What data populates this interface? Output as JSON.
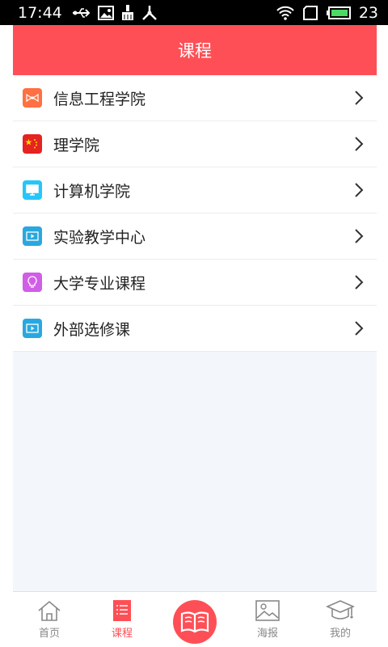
{
  "status_bar": {
    "time": "17:44",
    "battery_percent": "23"
  },
  "header": {
    "title": "课程"
  },
  "courses": [
    {
      "label": "信息工程学院",
      "icon": "bowtie-icon",
      "color": "#ff7043"
    },
    {
      "label": "理学院",
      "icon": "flag-icon",
      "color": "#e52320"
    },
    {
      "label": "计算机学院",
      "icon": "monitor-icon",
      "color": "#26c6f9"
    },
    {
      "label": "实验教学中心",
      "icon": "video-screen-icon",
      "color": "#29a8e0"
    },
    {
      "label": "大学专业课程",
      "icon": "lightbulb-icon",
      "color": "#d05ee6"
    },
    {
      "label": "外部选修课",
      "icon": "video-screen-icon",
      "color": "#29a8e0"
    }
  ],
  "tabs": [
    {
      "label": "首页",
      "icon": "home-icon"
    },
    {
      "label": "课程",
      "icon": "list-icon",
      "active": true
    },
    {
      "label": "",
      "icon": "book-icon"
    },
    {
      "label": "海报",
      "icon": "image-icon"
    },
    {
      "label": "我的",
      "icon": "graduation-cap-icon"
    }
  ],
  "colors": {
    "accent": "#ff4f56",
    "background": "#f3f6fa"
  }
}
